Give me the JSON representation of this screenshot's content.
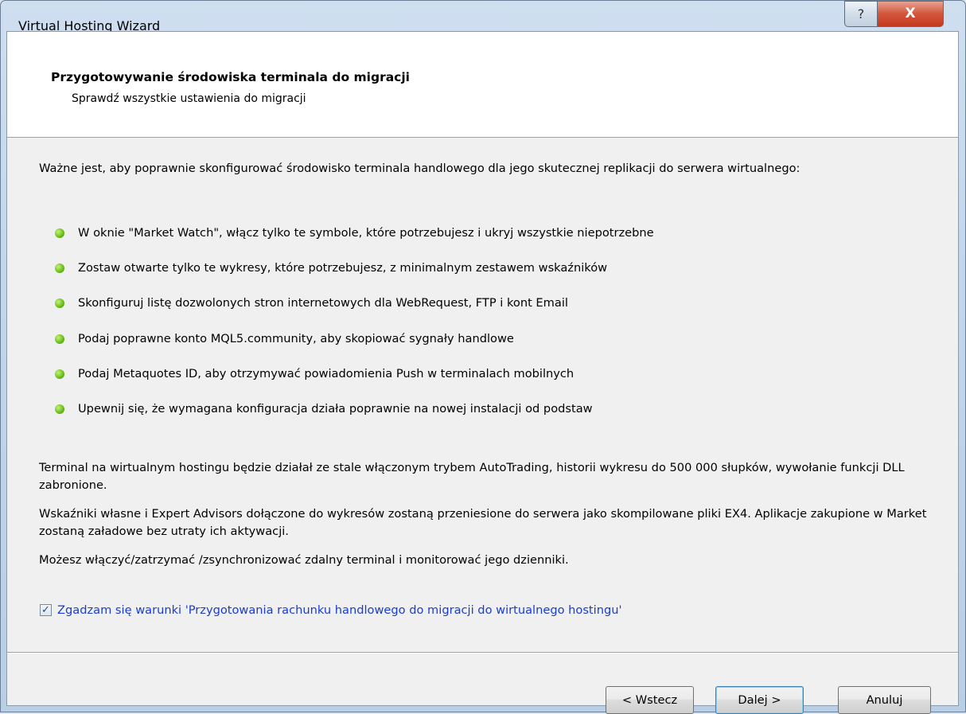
{
  "window": {
    "title": "Virtual Hosting Wizard",
    "help_glyph": "?",
    "close_glyph": "X"
  },
  "header": {
    "title": "Przygotowywanie środowiska terminala do migracji",
    "subtitle": "Sprawdź wszystkie ustawienia do migracji"
  },
  "content": {
    "intro": "Ważne jest, aby poprawnie skonfigurować środowisko terminala handlowego dla jego skutecznej replikacji do serwera wirtualnego:",
    "bullets": [
      "W oknie \"Market Watch\", włącz tylko te symbole, które potrzebujesz i ukryj wszystkie niepotrzebne",
      "Zostaw otwarte tylko te wykresy, które potrzebujesz, z minimalnym zestawem wskaźników",
      "Skonfiguruj listę dozwolonych stron internetowych dla WebRequest, FTP i kont Email",
      "Podaj poprawne konto MQL5.community, aby skopiować sygnały handlowe",
      "Podaj Metaquotes ID, aby otrzymywać powiadomienia Push w terminalach mobilnych",
      "Upewnij się, że wymagana konfiguracja działa poprawnie na nowej instalacji od podstaw"
    ],
    "para1": "Terminal na wirtualnym hostingu będzie działał ze stale włączonym trybem AutoTrading, historii wykresu do 500 000 słupków, wywołanie funkcji DLL zabronione.",
    "para2": "Wskaźniki własne i Expert Advisors dołączone do wykresów zostaną przeniesione do serwera jako skompilowane pliki EX4. Aplikacje zakupione w Market zostaną załadowe bez utraty ich aktywacji.",
    "para3": "Możesz włączyć/zatrzymać /zsynchronizować zdalny terminal i monitorować jego dzienniki.",
    "agree_label": "Zgadzam się warunki 'Przygotowania rachunku handlowego do migracji do wirtualnego hostingu'",
    "agree_checked": true
  },
  "buttons": {
    "back": "< Wstecz",
    "next": "Dalej >",
    "cancel": "Anuluj"
  },
  "colors": {
    "bullet": "#6cc21c",
    "link_text": "#1a3ccf",
    "close_button": "#c43a1f"
  },
  "icons": {
    "bullet": "green-dot-icon",
    "check": "checkmark-icon"
  }
}
